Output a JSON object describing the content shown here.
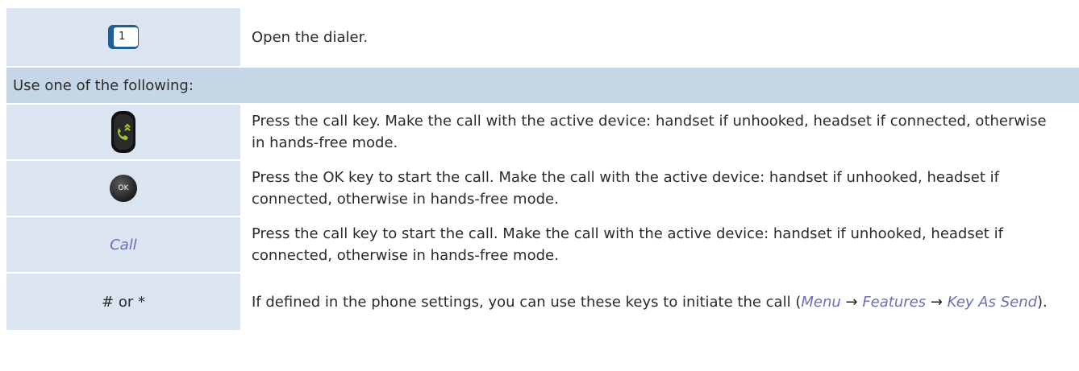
{
  "row1": {
    "icon": "dialer-key-icon",
    "key_digit": "1",
    "text": "Open the dialer."
  },
  "section": {
    "text": "Use one of the following:"
  },
  "row2": {
    "icon": "call-key-icon",
    "text": "Press the call key. Make the call with the active device: handset if unhooked, headset if connected, otherwise in hands-free mode."
  },
  "row3": {
    "icon": "ok-key-icon",
    "key_label": "OK",
    "text": "Press the OK key to start the call. Make the call with the active device: handset if unhooked, headset if connected, otherwise in hands-free mode."
  },
  "row4": {
    "label": "Call",
    "text": "Press the call key to start the call. Make the call with the active device: handset if unhooked, headset if connected, otherwise in hands-free mode."
  },
  "row5": {
    "label": "# or *",
    "text_before": "If defined in the phone settings, you can use these keys to initiate the call (",
    "menu": "Menu",
    "arrow": "→",
    "features": "Features",
    "key_as_send": "Key As Send",
    "text_after": ")."
  },
  "colors": {
    "row_bg": "#dbe5f1",
    "section_bg": "#c5d7e7",
    "link": "#6a6fb5",
    "call_key_arrow": "#9acd32"
  }
}
